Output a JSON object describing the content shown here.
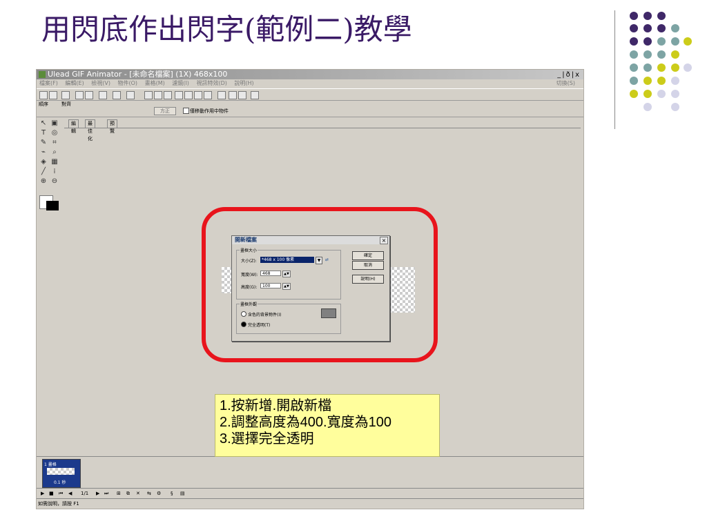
{
  "slide": {
    "title": "用閃底作出閃字(範例二)教學",
    "callout": [
      "1.按新增.開啟新檔",
      "2.調整高度為400.寬度為100",
      "3.選擇完全透明"
    ]
  },
  "colors": {
    "purple": "#3f2868",
    "teal": "#7da4a4",
    "olive": "#cccc1a",
    "lavender": "#d4d4e8",
    "highlight": "#e8141c",
    "callout_bg": "#fffe9c"
  },
  "screenshot": {
    "window_title": "Ulead GIF Animator - [未命名檔案] (1X) 468x100",
    "window_buttons": "_|ð|x",
    "menus": [
      "檔案(F)",
      "編輯(E)",
      "檢視(V)",
      "物件(O)",
      "畫格(M)",
      "濾鏡(I)",
      "視訊特效(D)",
      "說明(H)"
    ],
    "menu_right": "切換(S)",
    "toolbar2": {
      "order_label": "順序",
      "align_label": "對齊",
      "apply_button": "方正",
      "checkbox_label": "僅移動作用中物件"
    },
    "tabs": [
      "編輯",
      "最佳化",
      "預覽"
    ],
    "dialog": {
      "title": "開新檔案",
      "canvas_size_group": "畫框大小",
      "size_label": "大小(Z):",
      "size_value": "*468 x 100 像素",
      "width_label": "寬度(W):",
      "width_value": "468",
      "height_label": "高度(G):",
      "height_value": "100",
      "ok_button": "確定",
      "cancel_button": "取消",
      "help_button": "說明(H)",
      "appearance_group": "畫框外觀",
      "option_bg_object": "含色的背景物件(I)",
      "option_transparent": "完全透明(T)"
    },
    "frame_panel": {
      "frame_label": "1 畫格",
      "frame_time": "0.1 秒"
    },
    "playbar_counter": "1/1",
    "status_text": "如需說明，請按 F1"
  }
}
